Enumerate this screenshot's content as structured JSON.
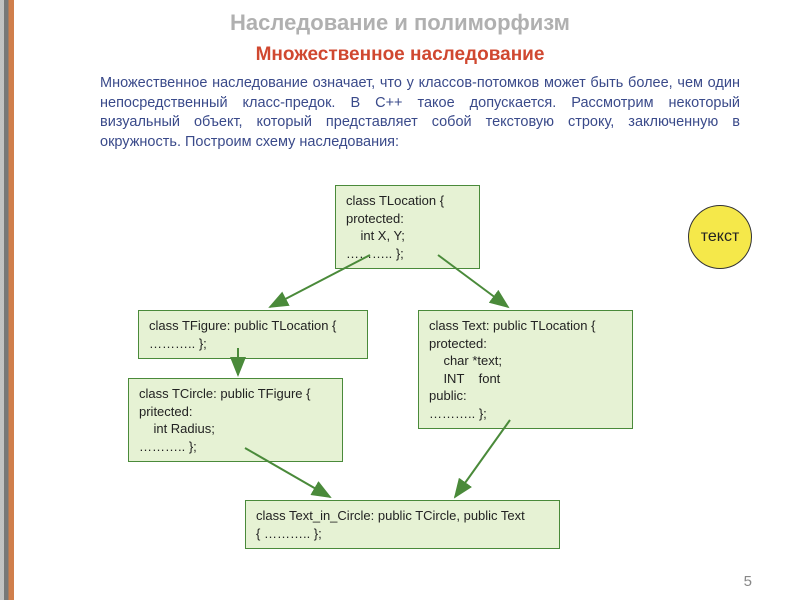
{
  "titles": {
    "main": "Наследование и полиморфизм",
    "sub": "Множественное наследование"
  },
  "paragraph": "Множественное наследование означает, что у классов-потомков может быть более, чем один непосредственный класс-предок. В С++ такое допускается. Рассмотрим некоторый визуальный объект, который представляет собой текстовую строку, заключенную в окружность. Построим схему наследования:",
  "diagram": {
    "boxes": {
      "tlocation": "class TLocation {\nprotected:\n    int X, Y;\n……….. };",
      "tfigure": "class TFigure: public TLocation {\n……….. };",
      "tcircle": "class TCircle: public TFigure {\npritected:\n    int Radius;\n……….. };",
      "text": "class Text: public TLocation {\nprotected:\n    char *text;\n    INT    font\npublic:\n……….. };",
      "text_in_circle": "class Text_in_Circle: public TCircle, public Text\n{ ……….. };"
    },
    "circle_label": "текст"
  },
  "slide_number": "5"
}
